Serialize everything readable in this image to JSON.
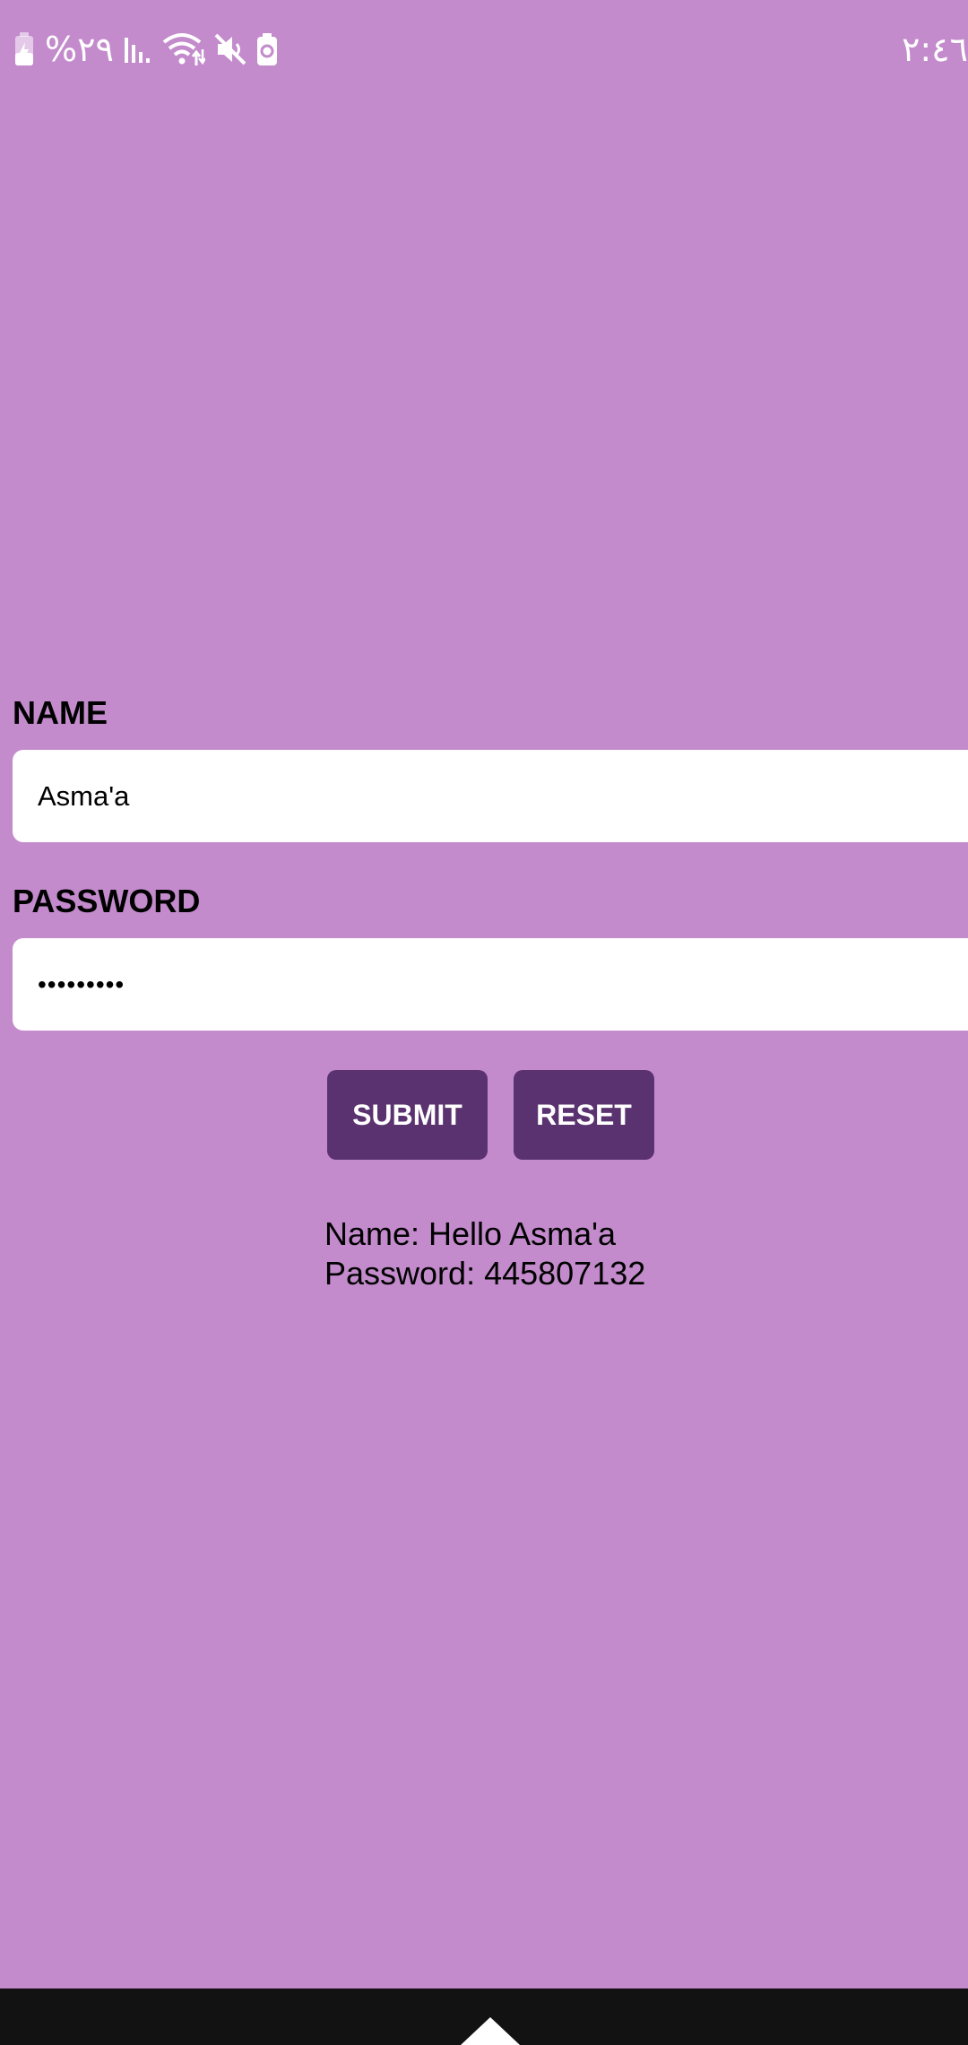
{
  "status_bar": {
    "battery_percent": "%٢٩",
    "time": "٢:٤٦",
    "icons": [
      "battery-charging-icon",
      "signal-icon",
      "wifi-icon",
      "mute-icon",
      "battery-saver-icon"
    ]
  },
  "form": {
    "name_label": "NAME",
    "name_value": "Asma'a",
    "password_label": "PASSWORD",
    "password_masked": "•••••••••",
    "submit_label": "SUBMIT",
    "reset_label": "RESET"
  },
  "output": {
    "name_line": "Name: Hello Asma'a",
    "password_line": "Password: 445807132"
  },
  "colors": {
    "background": "#c38bcc",
    "button": "#5b3270",
    "nav_bar": "#121212"
  }
}
